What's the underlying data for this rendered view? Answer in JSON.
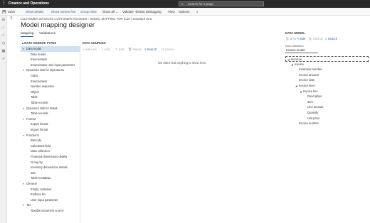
{
  "app": {
    "title": "Finance and Operations",
    "search_placeholder": "Search for a page"
  },
  "actions": {
    "save": "Save",
    "show_details": "Show details",
    "show_names_first": "Show names first",
    "group_view": "Group view",
    "show_all": "Show all",
    "validate": "Validate",
    "start_debugging": "Start Debugging",
    "view": "View",
    "options": "Options"
  },
  "breadcrumb": "CUSTOMER INVOICES CUSTOMER INVOICES : MODEL MAPPING FOR CUS  |  Standard view",
  "page_title": "Model mapping designer",
  "tabs": {
    "mapping": "Mapping",
    "validations": "Validations"
  },
  "types_panel": {
    "header": "DATA SOURCE TYPES",
    "rows": [
      {
        "label": "Data model",
        "level": 1,
        "caret": "▾",
        "selected": true
      },
      {
        "label": "Data model",
        "level": 2,
        "caret": ""
      },
      {
        "label": "Enumeration",
        "level": 2,
        "caret": ""
      },
      {
        "label": "Enumeration user input parameter",
        "level": 2,
        "caret": ""
      },
      {
        "label": "Dynamics 365 for Operations",
        "level": 1,
        "caret": "▾"
      },
      {
        "label": "Class",
        "level": 2,
        "caret": ""
      },
      {
        "label": "Enumeration",
        "level": 2,
        "caret": ""
      },
      {
        "label": "Number sequence",
        "level": 2,
        "caret": ""
      },
      {
        "label": "Object",
        "level": 2,
        "caret": ""
      },
      {
        "label": "Table",
        "level": 2,
        "caret": ""
      },
      {
        "label": "Table records",
        "level": 2,
        "caret": ""
      },
      {
        "label": "Dynamics 365 for Retail",
        "level": 1,
        "caret": "▾"
      },
      {
        "label": "Table records",
        "level": 2,
        "caret": ""
      },
      {
        "label": "Format",
        "level": 1,
        "caret": "▾"
      },
      {
        "label": "Export format",
        "level": 2,
        "caret": ""
      },
      {
        "label": "Import format",
        "level": 2,
        "caret": ""
      },
      {
        "label": "Functions",
        "level": 1,
        "caret": "▾"
      },
      {
        "label": "Barcode",
        "level": 2,
        "caret": ""
      },
      {
        "label": "Calculated field",
        "level": 2,
        "caret": ""
      },
      {
        "label": "Data collection",
        "level": 2,
        "caret": ""
      },
      {
        "label": "Financial dimensions details",
        "level": 2,
        "caret": ""
      },
      {
        "label": "Group by",
        "level": 2,
        "caret": ""
      },
      {
        "label": "Inventory dimensions details",
        "level": 2,
        "caret": ""
      },
      {
        "label": "Join",
        "level": 2,
        "caret": ""
      },
      {
        "label": "Table metadata",
        "level": 2,
        "caret": ""
      },
      {
        "label": "General",
        "level": 1,
        "caret": "▾"
      },
      {
        "label": "Empty container",
        "level": 2,
        "caret": ""
      },
      {
        "label": "Endless list",
        "level": 2,
        "caret": ""
      },
      {
        "label": "User input parameter",
        "level": 2,
        "caret": ""
      },
      {
        "label": "Tax",
        "level": 1,
        "caret": "▾"
      },
      {
        "label": "Taxable document source",
        "level": 2,
        "caret": ""
      }
    ]
  },
  "datasources": {
    "header": "DATA SOURCES",
    "toolbar": {
      "add_root": "+ Add root",
      "add": "+ Add",
      "edit": "✎ Edit",
      "delete": "🗑 Delete",
      "search": "⌕ Search",
      "cache": "⟳ Cache"
    },
    "empty_message": "We didn't find anything to show here."
  },
  "datamodel": {
    "header": "DATA MODEL",
    "toolbar": {
      "bind": "⛓ Bind",
      "edit": "✎ Edit",
      "unbind": "⛓ Unbind",
      "search": "⌕ Search"
    },
    "root_label": "Root definition",
    "root_value": "Invoice model",
    "rows": [
      {
        "label": "Invoices",
        "level": 0,
        "caret": "◢",
        "selected": true
      },
      {
        "label": "Invoice",
        "level": 1,
        "caret": "◢"
      },
      {
        "label": "Customer number",
        "level": 2,
        "caret": ""
      },
      {
        "label": "Invoice amount",
        "level": 2,
        "caret": ""
      },
      {
        "label": "Invoice date",
        "level": 2,
        "caret": ""
      },
      {
        "label": "Invoice lines",
        "level": 2,
        "caret": "◢"
      },
      {
        "label": "Invoice line",
        "level": 3,
        "caret": "◢"
      },
      {
        "label": "Description",
        "level": 4,
        "caret": ""
      },
      {
        "label": "Item",
        "level": 4,
        "caret": ""
      },
      {
        "label": "Line amount",
        "level": 4,
        "caret": ""
      },
      {
        "label": "Quantity",
        "level": 4,
        "caret": ""
      },
      {
        "label": "Unit price",
        "level": 4,
        "caret": ""
      },
      {
        "label": "Invoice number",
        "level": 2,
        "caret": ""
      }
    ]
  }
}
